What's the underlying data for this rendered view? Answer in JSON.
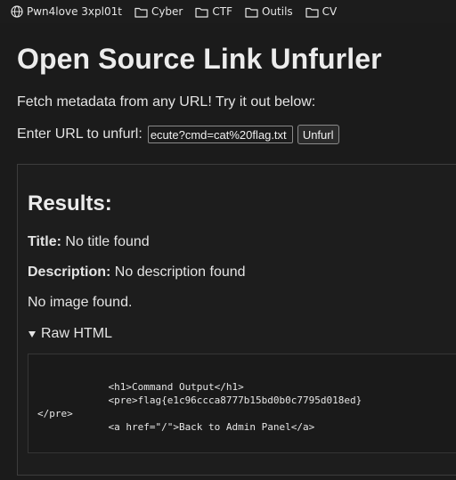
{
  "bookmarks": [
    {
      "label": "Pwn4love 3xpl01t",
      "icon": "globe-icon"
    },
    {
      "label": "Cyber",
      "icon": "folder-icon"
    },
    {
      "label": "CTF",
      "icon": "folder-icon"
    },
    {
      "label": "Outils",
      "icon": "folder-icon"
    },
    {
      "label": "CV",
      "icon": "folder-icon"
    }
  ],
  "page": {
    "title": "Open Source Link Unfurler",
    "intro": "Fetch metadata from any URL! Try it out below:",
    "url_label": "Enter URL to unfurl:",
    "url_value": "ecute?cmd=cat%20flag.txt",
    "button_label": "Unfurl"
  },
  "results": {
    "heading": "Results:",
    "title_label": "Title:",
    "title_value": "No title found",
    "description_label": "Description:",
    "description_value": "No description found",
    "image_text": "No image found.",
    "raw_summary": "Raw HTML",
    "raw_html": "\n            <h1>Command Output</h1>\n            <pre>flag{e1c96ccca8777b15bd0b0c7795d018ed}\n</pre>\n            <a href=\"/\">Back to Admin Panel</a>\n"
  }
}
